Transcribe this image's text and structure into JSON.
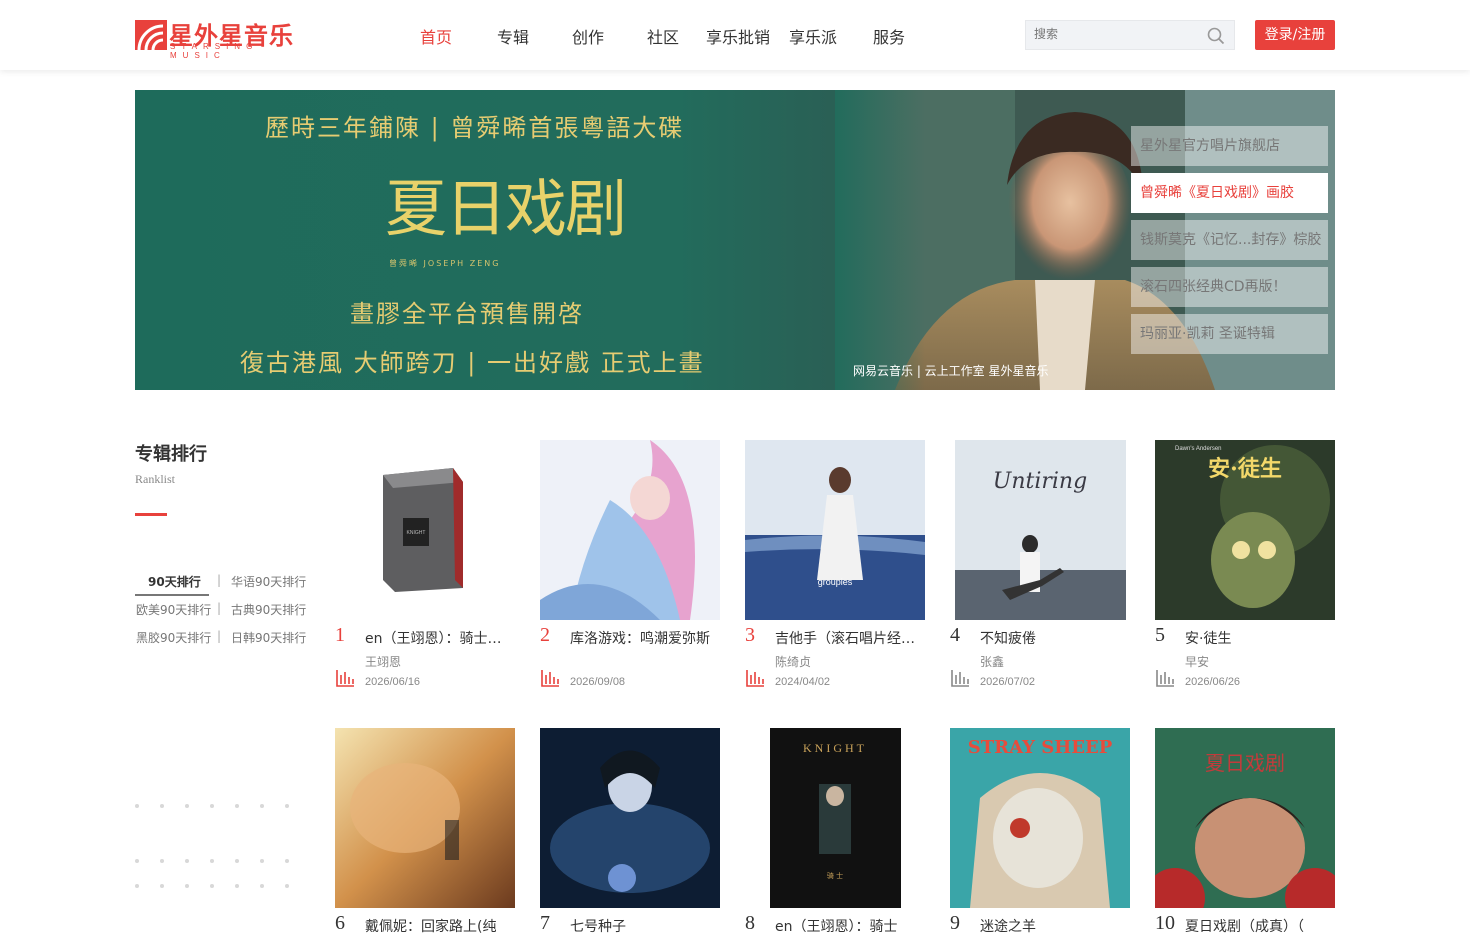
{
  "header": {
    "logo_name": "星外星音乐",
    "logo_sub": "STARSING MUSIC",
    "nav": [
      "首页",
      "专辑",
      "创作",
      "社区",
      "享乐批销",
      "享乐派",
      "服务"
    ],
    "active_nav": "首页",
    "search_placeholder": "搜索",
    "login_label": "登录/注册"
  },
  "banner": {
    "line1": "歷時三年鋪陳 | 曾舜晞首張粵語大碟",
    "title": "夏日戏剧",
    "subtitle": "曾舜晞 JOSEPH ZENG",
    "line2": "畫膠全平台預售開啓",
    "line3": "復古港風 大師跨刀 | 一出好戲 正式上畫",
    "logos": "网易云音乐 | 云上工作室  星外星音乐",
    "menu": [
      "星外星官方唱片旗舰店",
      "曾舜晞《夏日戏剧》画胶",
      "钱斯莫克《记忆...封存》棕胶",
      "滚石四张经典CD再版！",
      "玛丽亚·凯莉 圣诞特辑"
    ],
    "active_menu_index": 1
  },
  "ranking": {
    "title": "专辑排行",
    "subtitle": "Ranklist",
    "tabs": [
      "90天排行",
      "华语90天排行",
      "欧美90天排行",
      "古典90天排行",
      "黑胶90天排行",
      "日韩90天排行"
    ],
    "active_tab": "90天排行"
  },
  "albums": [
    {
      "rank": "1",
      "title": "en（王翊恩）：骑士（KNIGHT）",
      "artist": "王翊恩",
      "date": "2026/06/16"
    },
    {
      "rank": "2",
      "title": "库洛游戏：鸣潮爱弥斯",
      "artist": "",
      "date": "2026/09/08"
    },
    {
      "rank": "3",
      "title": "吉他手（滚石唱片经典再版）",
      "artist": "陈绮贞",
      "date": "2024/04/02"
    },
    {
      "rank": "4",
      "title": "不知疲倦",
      "artist": "张鑫",
      "date": "2026/07/02"
    },
    {
      "rank": "5",
      "title": "安·徒生",
      "artist": "早安",
      "date": "2026/06/26"
    },
    {
      "rank": "6",
      "title": "戴佩妮：回家路上(纯",
      "artist": "",
      "date": ""
    },
    {
      "rank": "7",
      "title": "七号种子",
      "artist": "",
      "date": ""
    },
    {
      "rank": "8",
      "title": "en（王翊恩）：骑士",
      "artist": "",
      "date": ""
    },
    {
      "rank": "9",
      "title": "迷途之羊",
      "artist": "",
      "date": ""
    },
    {
      "rank": "10",
      "title": "夏日戏剧（成真）（",
      "artist": "",
      "date": ""
    }
  ],
  "cover_text": {
    "knight": "KNIGHT",
    "knight_sub": "骑 士",
    "stray_sheep": "STRAY SHEEP",
    "andersen": "安·徒生",
    "andersen_en": "Dawn's Andersen",
    "groupies": "groupies",
    "summer": "夏日戏剧",
    "untiring": "Untiring"
  },
  "colors": {
    "accent": "#e8413c",
    "banner_green": "#226c5c",
    "banner_gold": "#e6cc72"
  }
}
